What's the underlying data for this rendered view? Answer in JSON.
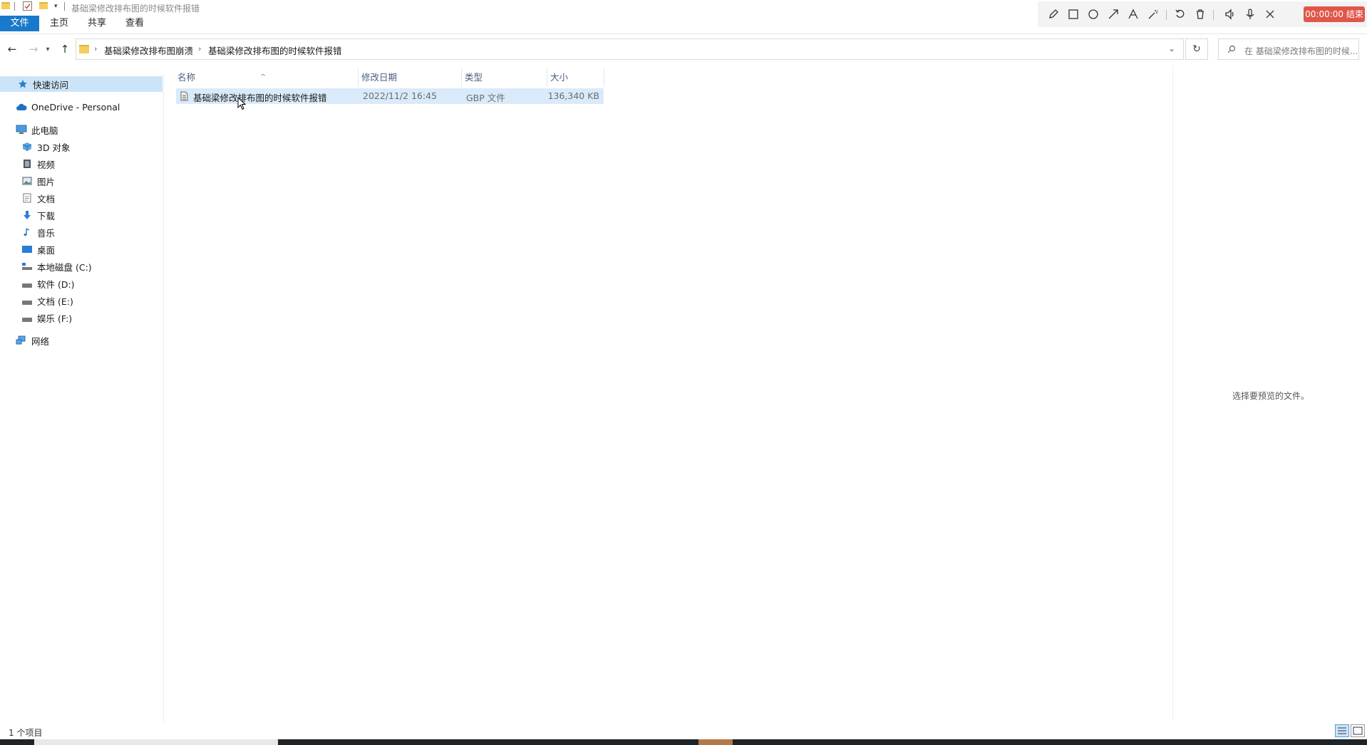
{
  "window": {
    "title": "基础梁修改排布图的时候软件报错"
  },
  "ribbon": {
    "tabs": [
      "文件",
      "主页",
      "共享",
      "查看"
    ]
  },
  "recorder": {
    "timer": "00:00:00 结束",
    "tools": [
      "pencil-icon",
      "rectangle-icon",
      "circle-icon",
      "arrow-icon",
      "text-icon",
      "magic-wand-icon",
      "undo-icon",
      "trash-icon",
      "speaker-icon",
      "microphone-icon",
      "close-icon"
    ]
  },
  "address": {
    "crumbs": [
      "基础梁修改排布图崩溃",
      "基础梁修改排布图的时候软件报错"
    ]
  },
  "search": {
    "placeholder": "在 基础梁修改排布图的时候..."
  },
  "sidebar": {
    "items": [
      {
        "label": "快速访问",
        "icon": "star-icon"
      },
      {
        "label": "OneDrive - Personal",
        "icon": "cloud-icon"
      },
      {
        "label": "此电脑",
        "icon": "computer-icon"
      },
      {
        "label": "3D 对象",
        "icon": "cube-icon"
      },
      {
        "label": "视频",
        "icon": "video-icon"
      },
      {
        "label": "图片",
        "icon": "picture-icon"
      },
      {
        "label": "文档",
        "icon": "document-icon"
      },
      {
        "label": "下载",
        "icon": "download-icon"
      },
      {
        "label": "音乐",
        "icon": "music-icon"
      },
      {
        "label": "桌面",
        "icon": "desktop-icon"
      },
      {
        "label": "本地磁盘 (C:)",
        "icon": "system-drive-icon"
      },
      {
        "label": "软件 (D:)",
        "icon": "drive-icon"
      },
      {
        "label": "文档 (E:)",
        "icon": "drive-icon"
      },
      {
        "label": "娱乐 (F:)",
        "icon": "drive-icon"
      },
      {
        "label": "网络",
        "icon": "network-icon"
      }
    ]
  },
  "columns": {
    "name": "名称",
    "modified": "修改日期",
    "type": "类型",
    "size": "大小"
  },
  "files": [
    {
      "name": "基础梁修改排布图的时候软件报错",
      "modified": "2022/11/2 16:45",
      "type": "GBP 文件",
      "size": "136,340 KB"
    }
  ],
  "preview": {
    "empty_text": "选择要预览的文件。"
  },
  "status": {
    "count": "1 个项目"
  },
  "colors": {
    "accent": "#1979ca",
    "selection": "#cce4f7",
    "recorder_timer": "#e0574a"
  }
}
